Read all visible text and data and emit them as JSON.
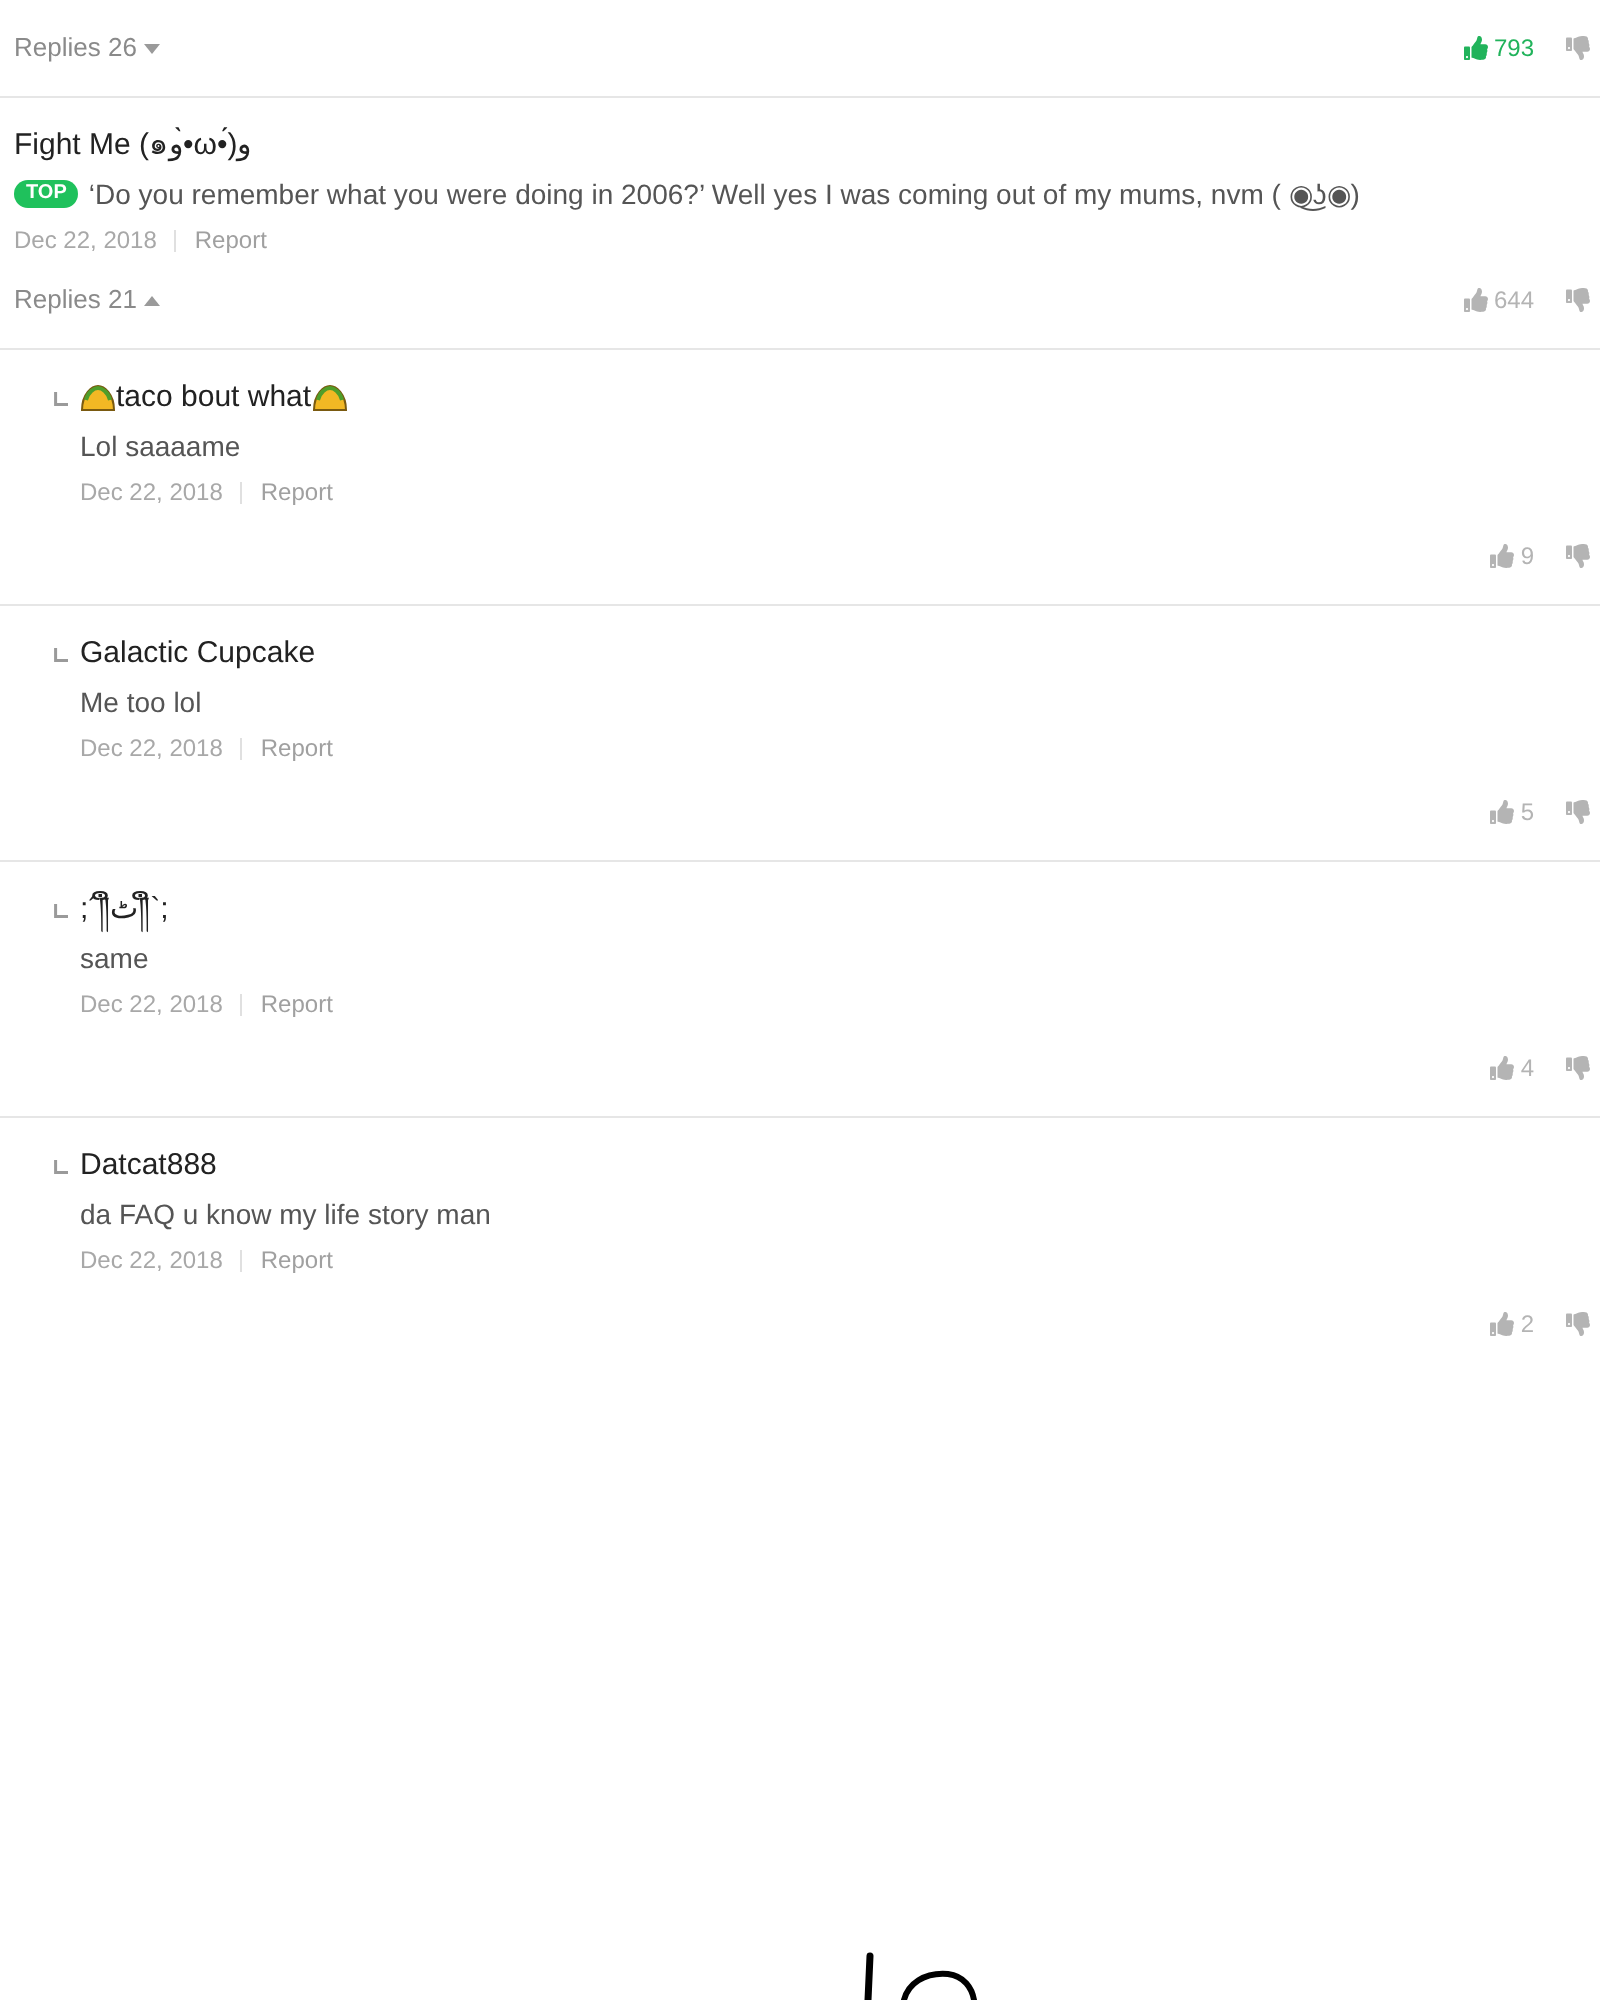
{
  "comments": [
    {
      "replies_label": "Replies 26",
      "replies_expanded": false,
      "likes": "793",
      "liked": true
    },
    {
      "author": "Fight Me (๑و•̀ω•́)و",
      "badge": "TOP",
      "text": "‘Do you remember what you were doing in 2006?’ Well yes I was coming out of my mums, nvm ( ◉͜ʖ◉)",
      "date": "Dec 22, 2018",
      "report": "Report",
      "replies_label": "Replies 21",
      "replies_expanded": true,
      "likes": "644",
      "liked": false,
      "replies": [
        {
          "author": "taco bout what",
          "icons_around_author": true,
          "text": "Lol saaaame",
          "date": "Dec 22, 2018",
          "report": "Report",
          "likes": "9",
          "liked": false
        },
        {
          "author": "Galactic Cupcake",
          "icons_around_author": false,
          "text": "Me too lol",
          "date": "Dec 22, 2018",
          "report": "Report",
          "likes": "5",
          "liked": false
        },
        {
          "author": ";´༎ຶٹ༎ຶ`;",
          "icons_around_author": false,
          "text": "same",
          "date": "Dec 22, 2018",
          "report": "Report",
          "likes": "4",
          "liked": false
        },
        {
          "author": "Datcat888",
          "icons_around_author": false,
          "text": "da FAQ u know my life story man",
          "date": "Dec 22, 2018",
          "report": "Report",
          "likes": "2",
          "liked": false
        }
      ]
    }
  ]
}
